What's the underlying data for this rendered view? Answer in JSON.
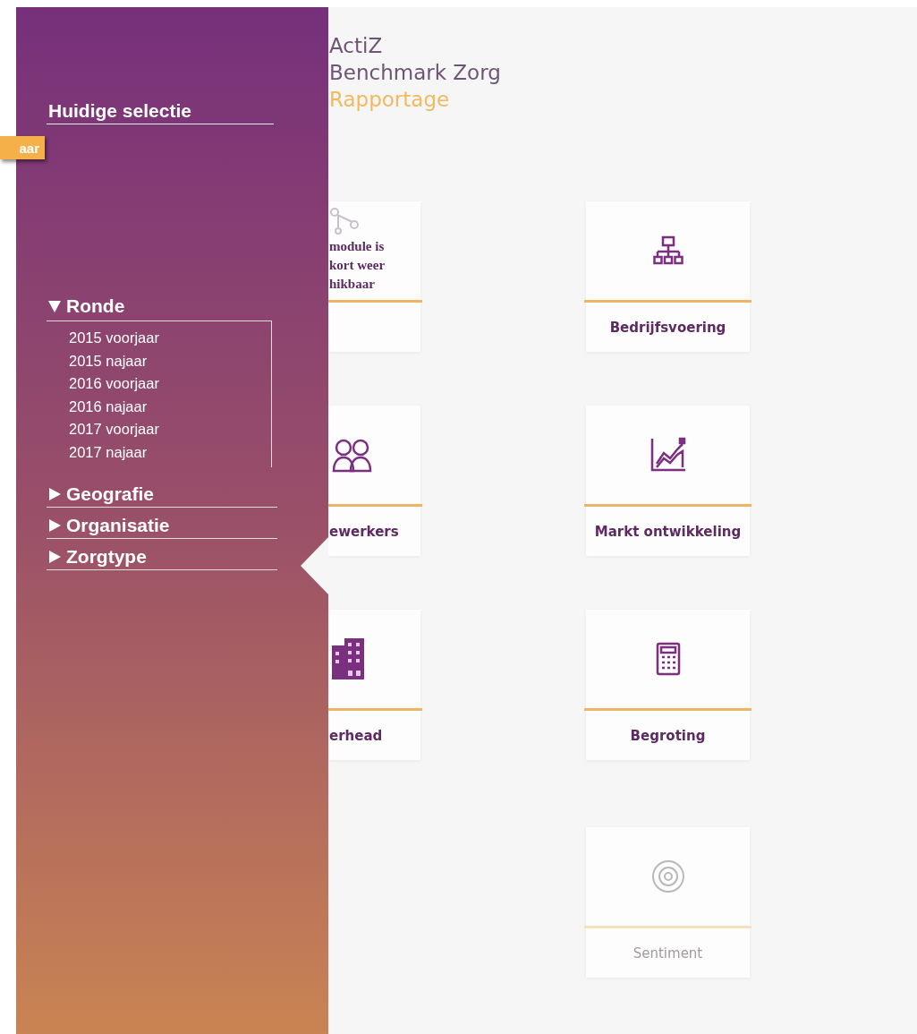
{
  "sidebar": {
    "heading": "Huidige selectie",
    "badge": "aar",
    "filters": [
      {
        "label": "Ronde",
        "expanded": true,
        "children": [
          {
            "label": "2015 voorjaar"
          },
          {
            "label": "2015 najaar"
          },
          {
            "label": "2016 voorjaar"
          },
          {
            "label": "2016 najaar"
          },
          {
            "label": "2017 voorjaar"
          },
          {
            "label": "2017 najaar"
          }
        ]
      },
      {
        "label": "Geografie",
        "expanded": false
      },
      {
        "label": "Organisatie",
        "expanded": false
      },
      {
        "label": "Zorgtype",
        "expanded": false
      }
    ]
  },
  "logo": {
    "lines": [
      "ActiZ",
      "Benchmark Zorg"
    ],
    "subtitle": "Rapportage"
  },
  "columns": [
    {
      "tiles": [
        {
          "kind": "notice",
          "lines": [
            "module is",
            "kort weer",
            "hikbaar"
          ]
        },
        {
          "kind": "tile",
          "title": "ewerkers",
          "disabled": false
        },
        {
          "kind": "tile",
          "title": "erhead",
          "disabled": false
        }
      ]
    },
    {
      "tiles": [
        {
          "kind": "tile",
          "title": "Bedrijfsvoering",
          "disabled": false
        },
        {
          "kind": "tile",
          "title": "Markt ontwikkeling",
          "disabled": false
        },
        {
          "kind": "tile",
          "title": "Begroting",
          "disabled": false
        },
        {
          "kind": "tile",
          "title": "Sentiment",
          "disabled": true
        }
      ]
    }
  ]
}
